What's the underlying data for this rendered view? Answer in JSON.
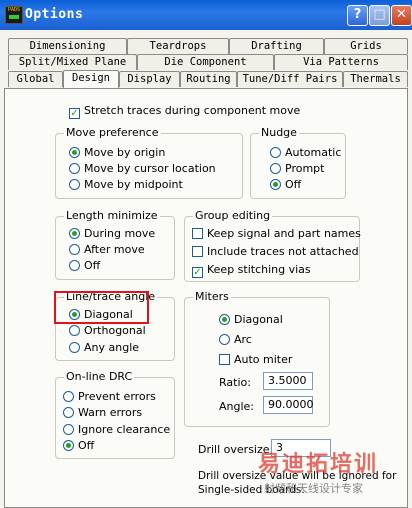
{
  "window": {
    "title": "Options",
    "app_icon_text": "PADS"
  },
  "tabs": {
    "row1": [
      "Dimensioning",
      "Teardrops",
      "Drafting",
      "Grids"
    ],
    "row2": [
      "Split/Mixed Plane",
      "Die Component",
      "Via Patterns"
    ],
    "row3": [
      "Global",
      "Design",
      "Display",
      "Routing",
      "Tune/Diff Pairs",
      "Thermals"
    ],
    "active": "Design"
  },
  "stretch_traces": {
    "label": "Stretch traces during component move",
    "checked": true
  },
  "move_preference": {
    "title": "Move preference",
    "options": [
      "Move by origin",
      "Move by cursor location",
      "Move by midpoint"
    ],
    "selected": "Move by origin"
  },
  "nudge": {
    "title": "Nudge",
    "options": [
      "Automatic",
      "Prompt",
      "Off"
    ],
    "selected": "Off"
  },
  "length_minimize": {
    "title": "Length minimize",
    "options": [
      "During move",
      "After move",
      "Off"
    ],
    "selected": "During move"
  },
  "group_editing": {
    "title": "Group editing",
    "options": [
      {
        "label": "Keep signal and part names",
        "checked": false
      },
      {
        "label": "Include traces not attached",
        "checked": false
      },
      {
        "label": "Keep stitching vias",
        "checked": true
      }
    ]
  },
  "line_trace_angle": {
    "title": "Line/trace angle",
    "options": [
      "Diagonal",
      "Orthogonal",
      "Any angle"
    ],
    "selected": "Diagonal"
  },
  "miters": {
    "title": "Miters",
    "options": [
      "Diagonal",
      "Arc"
    ],
    "selected": "Diagonal",
    "auto_miter": {
      "label": "Auto miter",
      "checked": false
    },
    "ratio": {
      "label": "Ratio:",
      "value": "3.5000"
    },
    "angle": {
      "label": "Angle:",
      "value": "90.0000"
    }
  },
  "online_drc": {
    "title": "On-line DRC",
    "options": [
      "Prevent errors",
      "Warn errors",
      "Ignore clearance",
      "Off"
    ],
    "selected": "Off"
  },
  "drill_oversize": {
    "label": "Drill oversize:",
    "value": "3"
  },
  "drill_note": [
    "Drill oversize value will be ignored for",
    "Single-sided boards."
  ],
  "watermark": {
    "main": "易迪拓培训",
    "sub": "射频和天线设计专家"
  },
  "colors": {
    "titlebar": "#0a5fd6",
    "highlight": "#e0121c",
    "radio_dot": "#2a9a28"
  }
}
